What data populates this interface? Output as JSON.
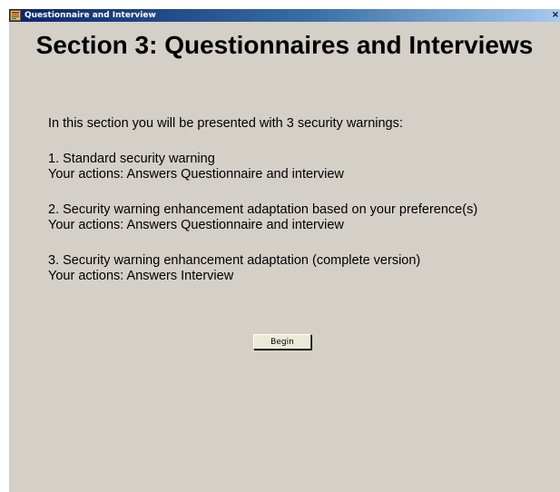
{
  "window": {
    "title": "Questionnaire and Interview",
    "close_glyph": "×"
  },
  "page": {
    "heading": "Section 3: Questionnaires and Interviews",
    "intro": "In this section you will be presented with 3 security warnings:",
    "items": [
      {
        "title": "1. Standard security warning",
        "actions": "Your actions: Answers Questionnaire and interview"
      },
      {
        "title": "2. Security warning enhancement adaptation based on your preference(s)",
        "actions": "Your actions: Answers Questionnaire and interview"
      },
      {
        "title": "3. Security warning enhancement adaptation (complete version)",
        "actions": "Your actions: Answers Interview"
      }
    ],
    "begin_label": "Begin"
  },
  "colors": {
    "window_background": "#d4d0c8",
    "titlebar_start": "#0a246a",
    "titlebar_end": "#a6caf0"
  },
  "icons": {
    "app": "form-window-icon",
    "close": "close-icon"
  }
}
